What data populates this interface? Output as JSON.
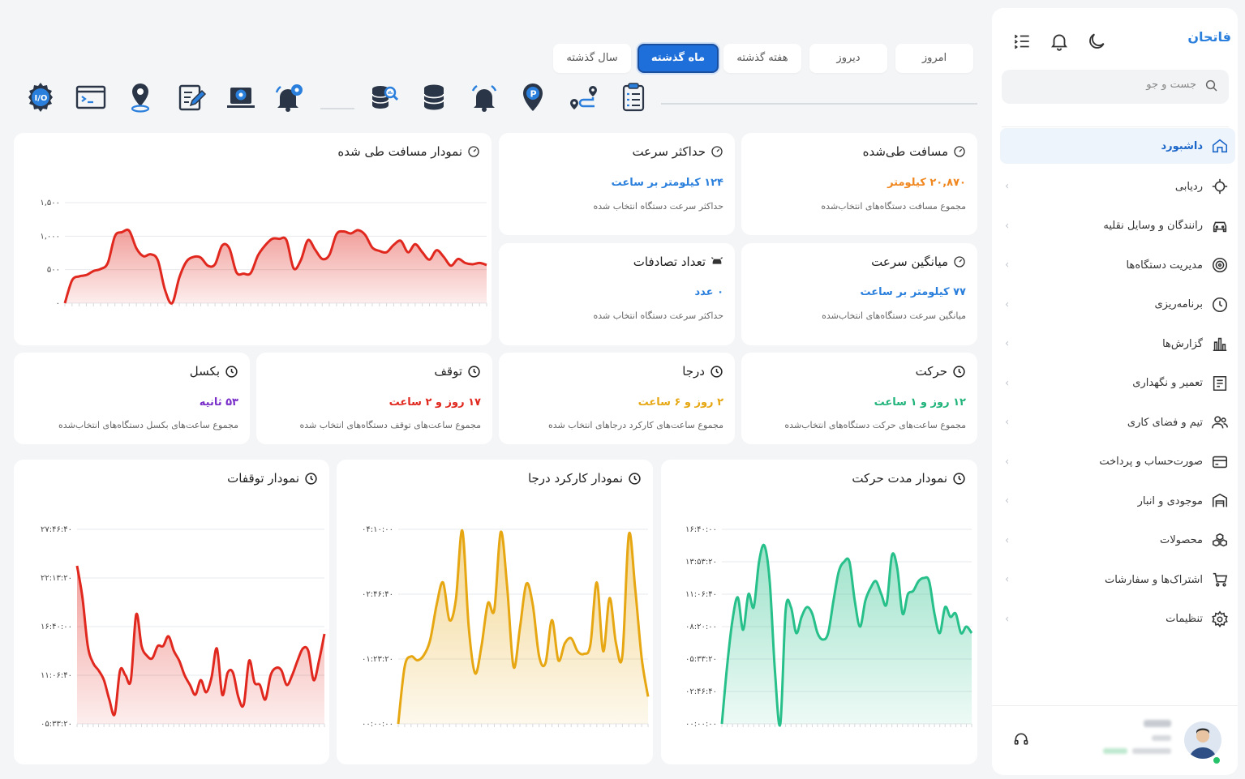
{
  "sidebar": {
    "brand": "فاتحان",
    "search_placeholder": "جست و جو",
    "items": [
      {
        "label": "داشبورد",
        "icon": "home-icon",
        "active": true
      },
      {
        "label": "ردیابی",
        "icon": "crosshair-icon"
      },
      {
        "label": "رانندگان و وسایل نقلیه",
        "icon": "car-icon"
      },
      {
        "label": "مدیریت دستگاه‌ها",
        "icon": "device-icon"
      },
      {
        "label": "برنامه‌ریزی",
        "icon": "clock-icon"
      },
      {
        "label": "گزارش‌ها",
        "icon": "bar-chart-icon"
      },
      {
        "label": "تعمیر و نگهداری",
        "icon": "maintenance-icon"
      },
      {
        "label": "تیم و فضای کاری",
        "icon": "team-icon"
      },
      {
        "label": "صورت‌حساب و پرداخت",
        "icon": "credit-card-icon"
      },
      {
        "label": "موجودی و انبار",
        "icon": "warehouse-icon"
      },
      {
        "label": "محصولات",
        "icon": "boxes-icon"
      },
      {
        "label": "اشتراک‌ها و سفارشات",
        "icon": "cart-icon"
      },
      {
        "label": "تنظیمات",
        "icon": "gear-icon"
      }
    ]
  },
  "tabs": [
    "امروز",
    "دیروز",
    "هفته گذشته",
    "ماه گذشته",
    "سال گذشته"
  ],
  "active_tab": "ماه گذشته",
  "toolbar_icons": [
    "clipboard-checklist-icon",
    "route-pin-icon",
    "parking-pin-icon",
    "alarm-bell-icon",
    "database-icon",
    "database-search-icon",
    "bell-settings-icon",
    "laptop-settings-icon",
    "edit-document-icon",
    "location-signal-icon",
    "terminal-window-icon",
    "io-gear-icon"
  ],
  "stats": {
    "distance": {
      "title": "مسافت طی‌شده",
      "value": "۲۰,۸۷۰ کیلومتر",
      "desc": "مجموع مسافت دستگاه‌های انتخاب‌شده",
      "color": "#f0861e"
    },
    "max_speed": {
      "title": "حداکثر سرعت",
      "value": "۱۲۴ کیلومتر بر ساعت",
      "desc": "حداکثر سرعت دستگاه انتخاب شده",
      "color": "#2a7fdc"
    },
    "avg_speed": {
      "title": "میانگین سرعت",
      "value": "۷۷ کیلومتر بر ساعت",
      "desc": "میانگین سرعت دستگاه‌های انتخاب‌شده",
      "color": "#2a7fdc"
    },
    "accidents": {
      "title": "تعداد تصادفات",
      "value": "۰ عدد",
      "desc": "حداکثر سرعت دستگاه انتخاب شده",
      "color": "#2a7fdc"
    },
    "movement": {
      "title": "حرکت",
      "value": "۱۲ روز و ۱ ساعت",
      "desc": "مجموع ساعت‌های حرکت دستگاه‌های انتخاب‌شده",
      "color": "#20b37a"
    },
    "darja": {
      "title": "درجا",
      "value": "۲ روز و ۶ ساعت",
      "desc": "مجموع ساعت‌های کارکرد درجاهای انتخاب شده",
      "color": "#e6a712"
    },
    "stop": {
      "title": "توقف",
      "value": "۱۷ روز و ۲ ساعت",
      "desc": "مجموع ساعت‌های توقف دستگاه‌های انتخاب شده",
      "color": "#e0281f"
    },
    "towing": {
      "title": "بکسل",
      "value": "۵۳ ثانیه",
      "desc": "مجموع ساعت‌های بکسل دستگاه‌های انتخاب‌شده",
      "color": "#7a2fc9"
    }
  },
  "chart_data": [
    {
      "type": "area",
      "title": "نمودار مسافت طی شده",
      "color": "#e0281f",
      "ylim": [
        0,
        1500
      ],
      "y_ticks": [
        "۰",
        "۵۰۰",
        "۱,۰۰۰",
        "۱,۵۰۰"
      ],
      "values": [
        0,
        340,
        400,
        420,
        480,
        510,
        600,
        1000,
        1060,
        1080,
        820,
        700,
        730,
        640,
        200,
        0,
        380,
        620,
        690,
        680,
        560,
        580,
        860,
        820,
        460,
        440,
        450,
        710,
        860,
        960,
        960,
        940,
        520,
        640,
        940,
        800,
        660,
        720,
        1030,
        1070,
        1040,
        1090,
        1020,
        830,
        780,
        760,
        870,
        930,
        760,
        880,
        760,
        650,
        790,
        690,
        560,
        660,
        600,
        580,
        600,
        570
      ]
    },
    {
      "type": "area",
      "title": "نمودار مدت حرکت",
      "color": "#27c08a",
      "y_ticks": [
        "۰۰:۰۰:۰۰",
        "۰۲:۴۶:۴۰",
        "۰۵:۳۳:۲۰",
        "۰۸:۲۰:۰۰",
        "۱۱:۰۶:۴۰",
        "۱۳:۵۳:۲۰",
        "۱۶:۴۰:۰۰"
      ],
      "ylim_seconds": [
        0,
        60000
      ],
      "values": [
        0,
        18000,
        32000,
        39000,
        29000,
        40000,
        36000,
        50000,
        55000,
        44000,
        16000,
        0,
        35000,
        36000,
        28000,
        33000,
        36000,
        34000,
        28000,
        26000,
        28000,
        38000,
        47000,
        50000,
        50000,
        38000,
        30000,
        38000,
        42000,
        44000,
        40000,
        37000,
        52000,
        48000,
        34000,
        40000,
        41000,
        44000,
        45000,
        44000,
        34000,
        28000,
        36000,
        33000,
        34000,
        28000,
        30000,
        28000
      ]
    },
    {
      "type": "area",
      "title": "نمودار کارکرد درجا",
      "color": "#e6a712",
      "y_ticks": [
        "۰۰:۰۰:۰۰",
        "۰۱:۲۳:۲۰",
        "۰۲:۴۶:۴۰",
        "۰۴:۱۰:۰۰"
      ],
      "ylim_seconds": [
        0,
        15000
      ],
      "values": [
        0,
        4400,
        5200,
        4900,
        5300,
        6500,
        9200,
        10900,
        8000,
        9600,
        14900,
        7500,
        3900,
        6000,
        9300,
        8800,
        14800,
        10600,
        4400,
        7400,
        10800,
        9200,
        5200,
        4700,
        8000,
        4900,
        6200,
        6600,
        5600,
        5400,
        6100,
        10900,
        5600,
        9700,
        6200,
        5300,
        14600,
        10400,
        5100,
        2100
      ]
    },
    {
      "type": "area",
      "title": "نمودار توقفات",
      "color": "#e0281f",
      "y_ticks": [
        "۰۵:۳۳:۲۰",
        "۱۱:۰۶:۴۰",
        "۱۶:۴۰:۰۰",
        "۲۲:۱۳:۲۰",
        "۲۷:۴۶:۴۰"
      ],
      "ylim_seconds": [
        20000,
        100000
      ],
      "values": [
        85000,
        72000,
        52000,
        45000,
        42000,
        38000,
        30000,
        24000,
        42000,
        40000,
        38000,
        65000,
        52000,
        48000,
        47000,
        52000,
        52000,
        56000,
        50000,
        46000,
        40000,
        36000,
        32000,
        38000,
        33000,
        39000,
        51000,
        32000,
        41000,
        41000,
        31000,
        28000,
        46000,
        37000,
        36000,
        30000,
        40000,
        43000,
        42000,
        36000,
        40000,
        46000,
        51000,
        50000,
        38000,
        46000,
        57000
      ]
    }
  ]
}
